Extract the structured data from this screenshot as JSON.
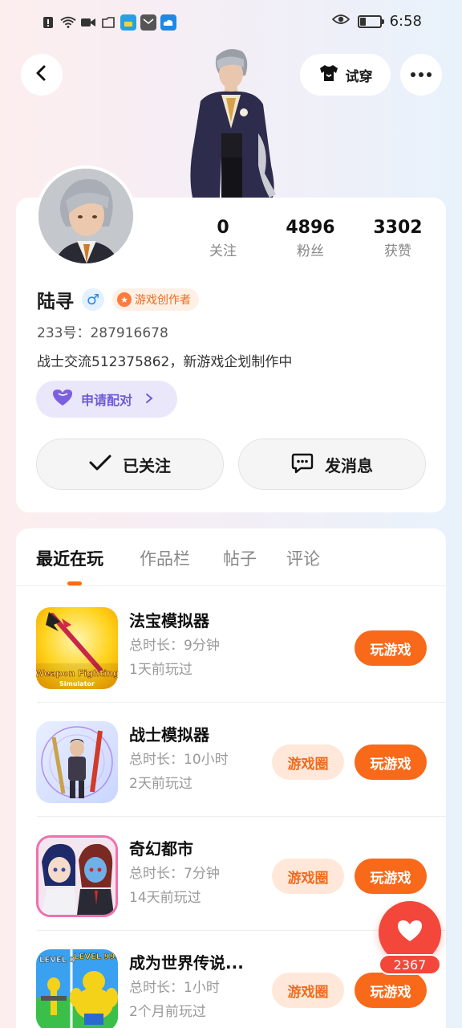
{
  "status_bar": {
    "time": "6:58",
    "battery_level": 0.3,
    "icons": [
      "alert-icon",
      "wifi-icon",
      "video-icon",
      "folder-icon",
      "app-icon",
      "mail-icon",
      "cloud-icon",
      "eye-icon",
      "battery-icon"
    ]
  },
  "header": {
    "back_icon": "chevron-left-icon",
    "try_on_label": "试穿",
    "more_icon": "more-dots-icon"
  },
  "profile": {
    "stats": [
      {
        "value": "0",
        "label": "关注"
      },
      {
        "value": "4896",
        "label": "粉丝"
      },
      {
        "value": "3302",
        "label": "获赞"
      }
    ],
    "name": "陆寻",
    "gender_symbol": "♂",
    "creator_badge": "游戏创作者",
    "uid": "233号：287916678",
    "bio": "战士交流512375862，新游戏企划制作中",
    "pair_button": "申请配对",
    "follow_button": "已关注",
    "message_button": "发消息"
  },
  "tabs": {
    "items": [
      "最近在玩",
      "作品栏",
      "帖子",
      "评论"
    ],
    "active": "最近在玩"
  },
  "games": [
    {
      "title": "法宝模拟器",
      "duration": "总时长：9分钟",
      "last_played": "1天前玩过",
      "circle_label": "",
      "play_label": "玩游戏",
      "icon_text_1": "Weapon Fighting",
      "icon_text_2": "Simulator"
    },
    {
      "title": "战士模拟器",
      "duration": "总时长：10小时",
      "last_played": "2天前玩过",
      "circle_label": "游戏圈",
      "play_label": "玩游戏"
    },
    {
      "title": "奇幻都市",
      "duration": "总时长：7分钟",
      "last_played": "14天前玩过",
      "circle_label": "游戏圈",
      "play_label": "玩游戏"
    },
    {
      "title": "成为世界传说...",
      "duration": "总时长：1小时",
      "last_played": "2个月前玩过",
      "circle_label": "游戏圈",
      "play_label": "玩游戏",
      "icon_text_1": "LEVEL 0",
      "icon_text_2": "LEVEL 999"
    }
  ],
  "like": {
    "count": "2367"
  },
  "colors": {
    "accent_orange": "#f8691a",
    "like_red": "#f2473a",
    "pair_purple": "#6f5bd6"
  }
}
